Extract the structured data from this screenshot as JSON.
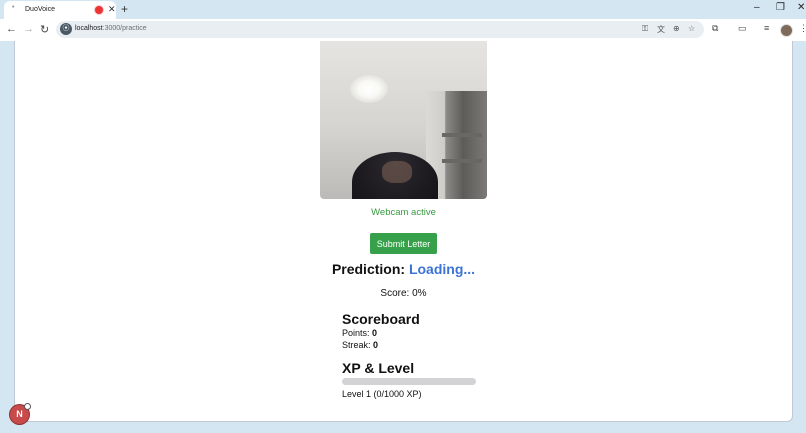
{
  "browser": {
    "tab_title": "DuoVoice",
    "new_tab_symbol": "+",
    "close_symbol": "✕",
    "url_host": "localhost",
    "url_path": ":3000/practice"
  },
  "page": {
    "webcam_status": "Webcam active",
    "submit_label": "Submit Letter",
    "prediction_label": "Prediction:",
    "prediction_value": "Loading...",
    "score_text": "Score: 0%",
    "scoreboard": {
      "title": "Scoreboard",
      "points_label": "Points:",
      "points_value": "0",
      "streak_label": "Streak:",
      "streak_value": "0"
    },
    "xp": {
      "title": "XP & Level",
      "progress_fraction": 0,
      "level_text": "Level 1 (0/1000 XP)"
    }
  },
  "dev_badge": {
    "letter": "N"
  },
  "colors": {
    "accent_green": "#36a14a",
    "status_green": "#3a9a43",
    "prediction_blue": "#3b74d4"
  }
}
